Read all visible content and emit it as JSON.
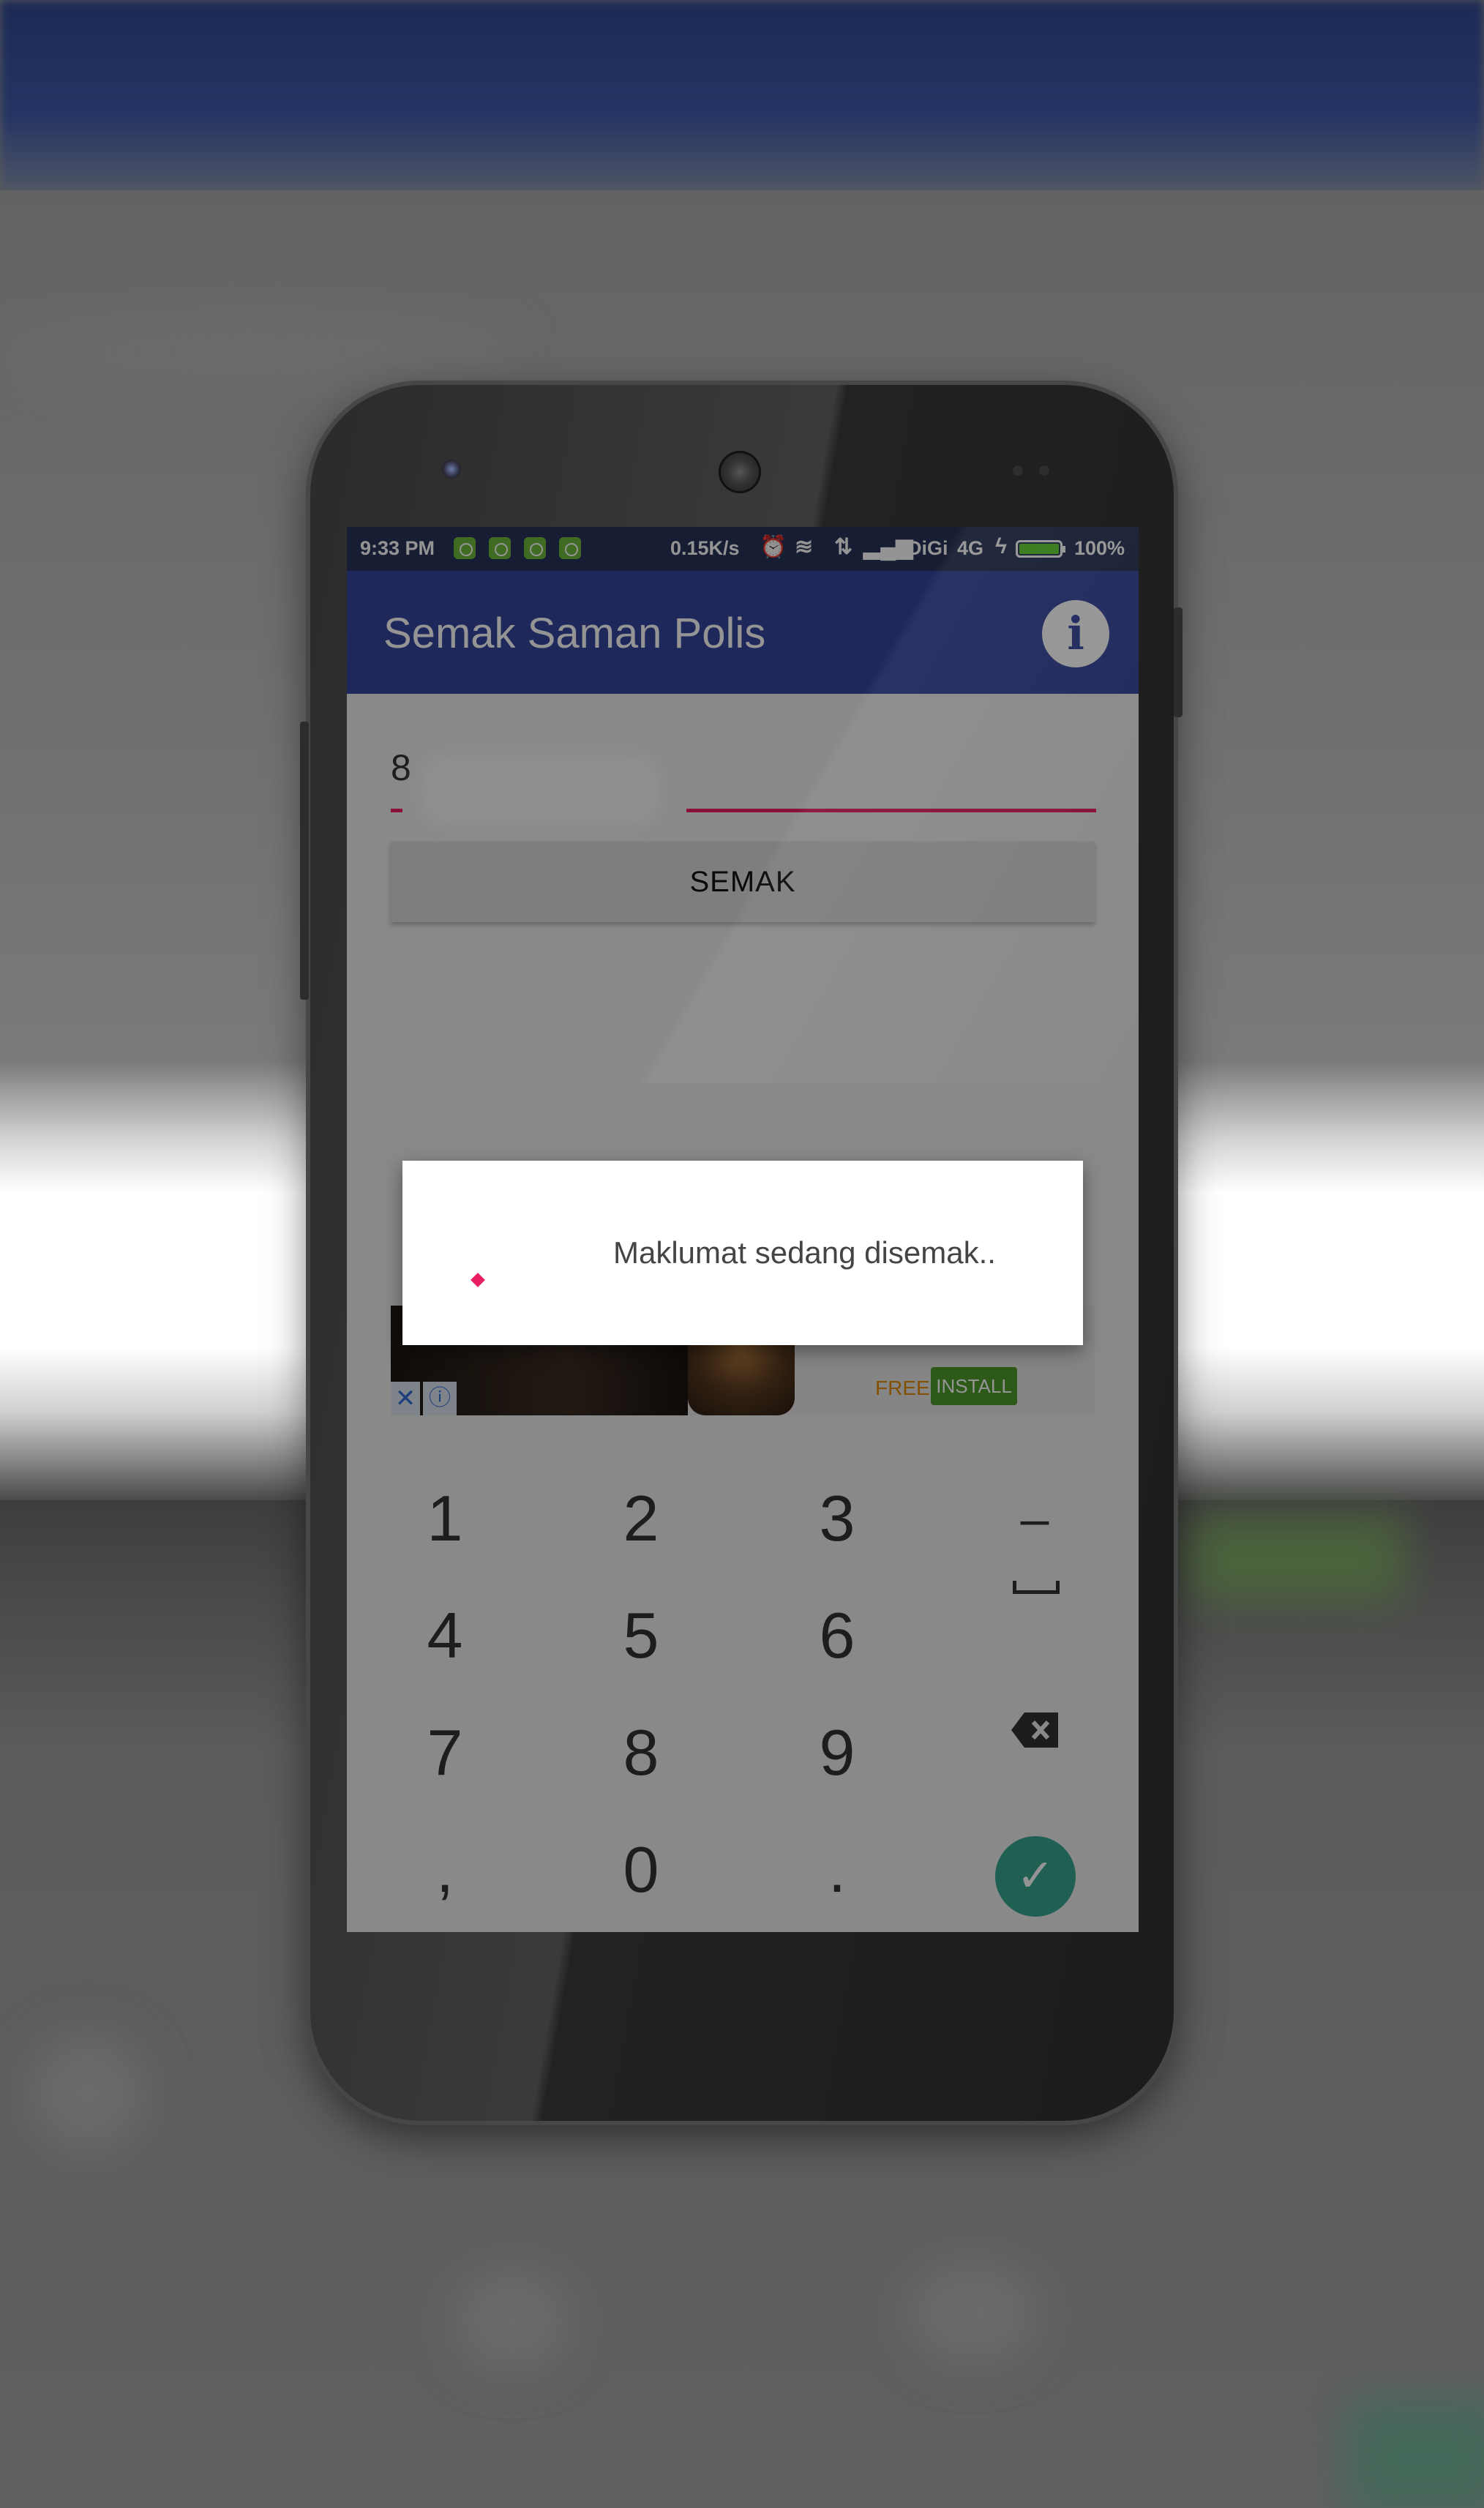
{
  "status_bar": {
    "time": "9:33 PM",
    "speed": "0.15K/s",
    "carrier": "DiGi",
    "network": "4G",
    "battery_percent": "100%",
    "battery_level": 1.0,
    "notification_icons": [
      "android-icon",
      "sim-icon",
      "android-icon",
      "android-icon"
    ]
  },
  "app_bar": {
    "title": "Semak Saman Polis",
    "info_icon": "i"
  },
  "form": {
    "plate_prefix": "8"
  },
  "check_button": "SEMAK",
  "ad": {
    "close": "✕",
    "info": "ⓘ",
    "free_label": "FREE",
    "install_label": "INSTALL"
  },
  "dialog": {
    "message": "Maklumat sedang disemak.."
  },
  "keyboard": {
    "keys": [
      [
        "1",
        "2",
        "3",
        "–"
      ],
      [
        "4",
        "5",
        "6",
        ""
      ],
      [
        "7",
        "8",
        "9",
        ""
      ],
      [
        ",",
        "0",
        ".",
        ""
      ]
    ],
    "done_icon": "✓"
  },
  "colors": {
    "app_bar": "#35469e",
    "status_bar": "#283459",
    "accent": "#e91e63",
    "done_key": "#36a690"
  }
}
